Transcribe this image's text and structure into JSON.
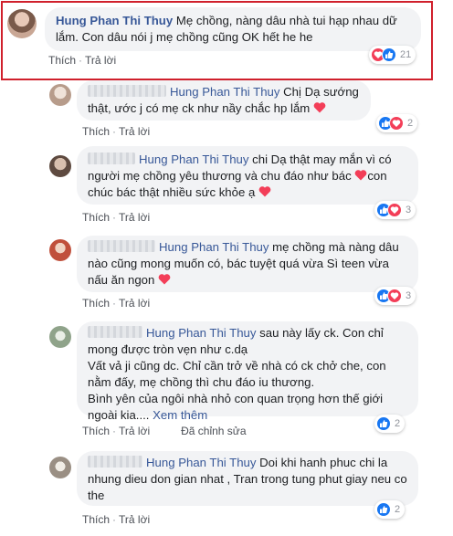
{
  "comments": [
    {
      "author": "Hung Phan Thi Thuy",
      "text": " Mẹ chồng, nàng dâu nhà tui hạp nhau dữ lắm. Con dâu nói j mẹ chồng cũng OK hết he he",
      "actions": {
        "like": "Thích",
        "reply": "Trả lời"
      },
      "reaction_count": "21"
    },
    {
      "mention": "Hung Phan Thi Thuy",
      "text": " Chị Dạ sướng thật, ước j có mẹ ck như nầy chắc hp lắm",
      "actions": {
        "like": "Thích",
        "reply": "Trả lời"
      },
      "reaction_count": "2"
    },
    {
      "mention": "Hung Phan Thi Thuy",
      "text": " chi Dạ thật may mắn vì có người mẹ chồng yêu thương và chu đáo như bác ",
      "text_after": "con chúc bác thật nhiều sức khỏe ạ",
      "actions": {
        "like": "Thích",
        "reply": "Trả lời"
      },
      "reaction_count": "3"
    },
    {
      "mention": "Hung Phan Thi Thuy",
      "text": " mẹ chồng mà nàng dâu nào cũng mong muốn có, bác tuyệt quá vừa Sì teen vừa nấu ăn ngon",
      "actions": {
        "like": "Thích",
        "reply": "Trả lời"
      },
      "reaction_count": "3"
    },
    {
      "mention": "Hung Phan Thi Thuy",
      "text": " sau này lấy ck. Con chỉ mong được tròn vẹn như c.dạ",
      "line2": "Vất vả ji cũng dc. Chỉ cần trở về nhà có ck chở che, con nằm đấy, mẹ chồng thì chu đáo iu thương.",
      "line3": "Bình yên của ngôi nhà nhỏ con quan trọng hơn thế giới ngoài kia.... ",
      "see_more": "Xem thêm",
      "actions": {
        "like": "Thích",
        "reply": "Trả lời",
        "edited": "Đã chỉnh sửa"
      },
      "reaction_count": "2"
    },
    {
      "mention": "Hung Phan Thi Thuy",
      "text": " Doi khi hanh phuc chi la nhung dieu don gian nhat , Tran trong tung phut giay neu co the",
      "actions": {
        "like": "Thích",
        "reply": "Trả lời"
      },
      "reaction_count": "2"
    }
  ],
  "colors": {
    "link": "#385898",
    "bubble": "#f2f3f5",
    "highlight": "#d0202c",
    "heart": "#f33e58",
    "like": "#1877f2"
  },
  "icons": [
    "heart-reaction-icon",
    "like-reaction-icon",
    "heart-emoji-icon"
  ]
}
